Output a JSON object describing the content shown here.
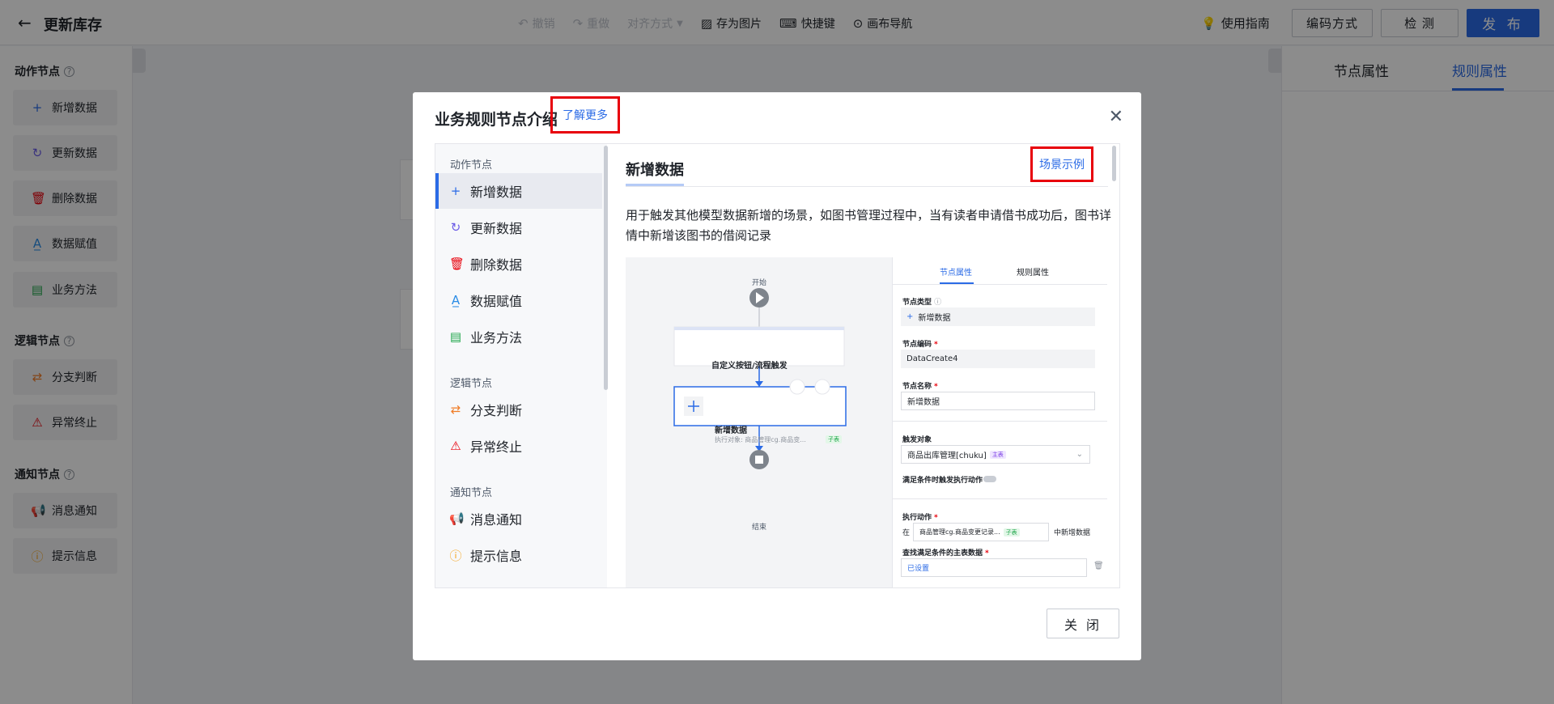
{
  "topbar": {
    "title": "更新库存",
    "tools": [
      {
        "label": "撤销",
        "icon": "undo-icon",
        "disabled": true
      },
      {
        "label": "重做",
        "icon": "redo-icon",
        "disabled": true
      },
      {
        "label": "对齐方式",
        "icon": "caret-down-icon",
        "disabled": true
      },
      {
        "label": "存为图片",
        "icon": "image-icon",
        "disabled": false
      },
      {
        "label": "快捷键",
        "icon": "keyboard-icon",
        "disabled": false
      },
      {
        "label": "画布导航",
        "icon": "compass-icon",
        "disabled": false
      }
    ],
    "guide": "使用指南",
    "encode_btn": "编码方式",
    "check_btn": "检 测",
    "publish_btn": "发 布"
  },
  "palette": {
    "action_group": "动作节点",
    "action_items": [
      "新增数据",
      "更新数据",
      "删除数据",
      "数据赋值",
      "业务方法"
    ],
    "logic_group": "逻辑节点",
    "logic_items": [
      "分支判断",
      "异常终止"
    ],
    "notify_group": "通知节点",
    "notify_items": [
      "消息通知",
      "提示信息"
    ]
  },
  "right_panel": {
    "tab_node": "节点属性",
    "tab_rule": "规则属性"
  },
  "modal": {
    "title": "业务规则节点介绍",
    "learn_more": "了解更多",
    "nav": {
      "action_group": "动作节点",
      "logic_group": "逻辑节点",
      "notify_group": "通知节点",
      "items": [
        "新增数据",
        "更新数据",
        "删除数据",
        "数据赋值",
        "业务方法",
        "分支判断",
        "异常终止",
        "消息通知",
        "提示信息"
      ]
    },
    "content": {
      "title": "新增数据",
      "scene_example": "场景示例",
      "description": "用于触发其他模型数据新增的场景，如图书管理过程中，当有读者申请借书成功后，图书详情中新增该图书的借阅记录"
    },
    "demo": {
      "start": "开始",
      "trigger_node": "自定义按钮/流程触发",
      "node_title": "新增数据",
      "node_sub": "执行对象: 商品管理cg.商品变...",
      "node_tag": "子表",
      "end": "结束",
      "tab_node": "节点属性",
      "tab_rule": "规则属性",
      "type_label": "节点类型",
      "type_value": "新增数据",
      "code_label": "节点编码",
      "code_value": "DataCreate4",
      "name_label": "节点名称",
      "name_value": "新增数据",
      "trigger_label": "触发对象",
      "trigger_value": "商品出库管理[chuku]",
      "trigger_tag": "主表",
      "cond_label": "满足条件时触发执行动作",
      "exec_label": "执行动作",
      "exec_prefix": "在",
      "exec_value": "商品管理cg.商品变更记录...",
      "exec_tag": "子表",
      "exec_suffix": "中新增数据",
      "query_label": "查找满足条件的主表数据",
      "query_value": "已设置"
    },
    "close_btn": "关 闭"
  }
}
